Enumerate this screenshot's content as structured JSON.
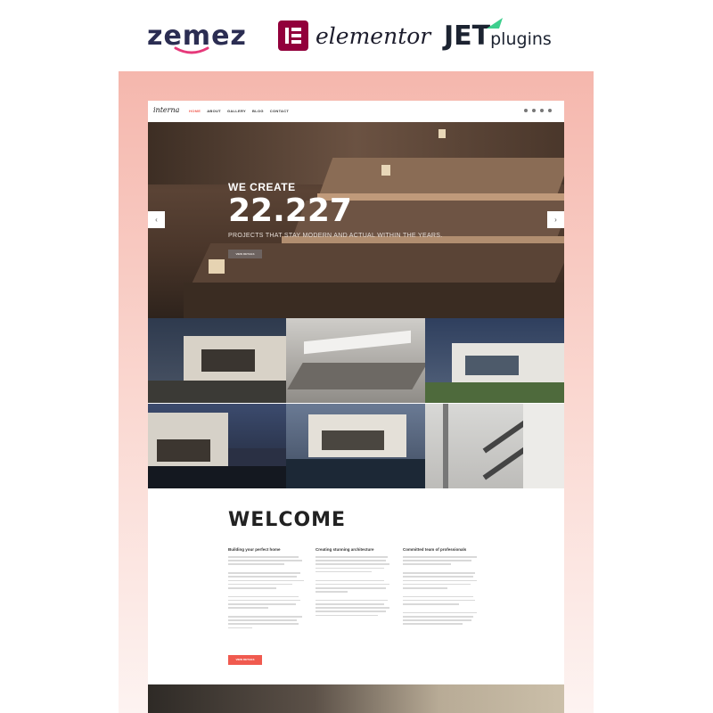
{
  "brands": {
    "zemez": "zemez",
    "elementor": "elementor",
    "jet_main": "JET",
    "jet_plugins": "plugins"
  },
  "site": {
    "logo": "interna",
    "menu": [
      "HOME",
      "ABOUT",
      "GALLERY",
      "BLOG",
      "CONTACT"
    ],
    "active_menu": "HOME",
    "social_icons": [
      "instagram-icon",
      "pinterest-icon",
      "twitter-icon",
      "facebook-icon"
    ]
  },
  "hero": {
    "line1": "WE CREATE",
    "number": "22.227",
    "subtitle": "PROJECTS THAT STAY MODERN AND ACTUAL WITHIN THE YEARS.",
    "button": "VIEW DETAILS",
    "prev_arrow": "‹",
    "next_arrow": "›"
  },
  "welcome": {
    "title": "WELCOME",
    "columns": [
      {
        "heading": "Building your perfect home"
      },
      {
        "heading": "Creating stunning architecture"
      },
      {
        "heading": "Committed team of professionals"
      }
    ],
    "button": "VIEW DETAILS"
  },
  "colors": {
    "accent": "#f05a4f",
    "mockup_top": "#f5b7ad",
    "dark_text": "#222222"
  }
}
